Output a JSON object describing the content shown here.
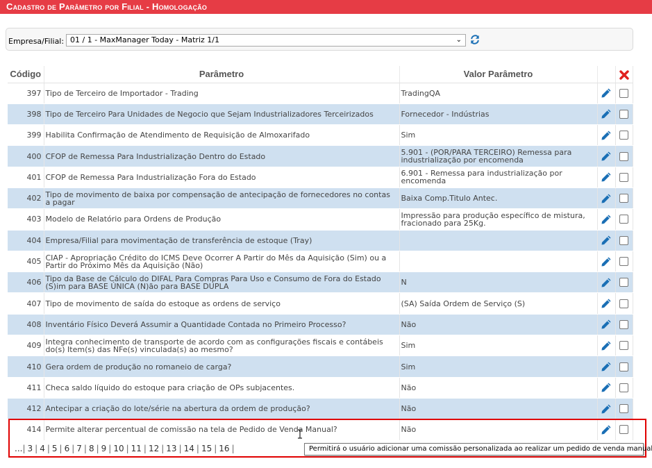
{
  "page": {
    "title": "Cadastro de Parâmetro por Filial  - Homologação"
  },
  "filter": {
    "label": "Empresa/Filial:",
    "selected": "01 / 1 - MaxManager Today - Matriz 1/1"
  },
  "table": {
    "headers": {
      "code": "Código",
      "param": "Parâmetro",
      "value": "Valor Parâmetro"
    },
    "rows": [
      {
        "code": "397",
        "param": "Tipo de Terceiro de Importador - Trading",
        "value": "TradingQA"
      },
      {
        "code": "398",
        "param": "Tipo de Terceiro Para Unidades de Negocio que Sejam Industrializadores Terceirizados",
        "value": "Fornecedor - Indústrias"
      },
      {
        "code": "399",
        "param": "Habilita Confirmação de Atendimento de Requisição de Almoxarifado",
        "value": "Sim"
      },
      {
        "code": "400",
        "param": "CFOP de Remessa Para Industrialização Dentro do Estado",
        "value": "5.901 - (POR/PARA TERCEIRO) Remessa para industrialização por encomenda"
      },
      {
        "code": "401",
        "param": "CFOP de Remessa Para Industrialização Fora do Estado",
        "value": "6.901 - Remessa para industrialização por encomenda"
      },
      {
        "code": "402",
        "param": "Tipo de movimento de baixa por compensação de antecipação de fornecedores no contas a pagar",
        "value": "Baixa Comp.Titulo Antec."
      },
      {
        "code": "403",
        "param": "Modelo de Relatório para Ordens de Produção",
        "value": "Impressão para produção específico de mistura, fracionado para 25Kg."
      },
      {
        "code": "404",
        "param": "Empresa/Filial para movimentação de transferência de estoque (Tray)",
        "value": ""
      },
      {
        "code": "405",
        "param": "CIAP - Apropriação Crédito do ICMS Deve Ocorrer A Partir do Mês da Aquisição (Sim) ou a Partir do Próximo Mês da Aquisição (Não)",
        "value": ""
      },
      {
        "code": "406",
        "param": "Tipo da Base de Cálculo do DIFAL Para Compras Para Uso e Consumo de Fora do Estado (S)im para BASE ÚNICA (N)ão para BASE DUPLA",
        "value": "N"
      },
      {
        "code": "407",
        "param": "Tipo de movimento de saída do estoque as ordens de serviço",
        "value": "(SA) Saída Ordem de Serviço (S)"
      },
      {
        "code": "408",
        "param": "Inventário Físico Deverá Assumir a Quantidade Contada no Primeiro Processo?",
        "value": "Não"
      },
      {
        "code": "409",
        "param": "Integra conhecimento de transporte de acordo com as configurações fiscais e contábeis do(s) Item(s) das NFe(s) vinculada(s) ao mesmo?",
        "value": "Sim"
      },
      {
        "code": "410",
        "param": "Gera ordem de produção no romaneio de carga?",
        "value": "Sim"
      },
      {
        "code": "411",
        "param": "Checa saldo líquido do estoque para criação de OPs subjacentes.",
        "value": "Não"
      },
      {
        "code": "412",
        "param": "Antecipar a criação do lote/série na abertura da ordem de produção?",
        "value": "Não"
      },
      {
        "code": "414",
        "param": "Permite alterar percentual de comissão na tela de Pedido de Venda Manual?",
        "value": "Não"
      }
    ]
  },
  "pager": {
    "prefix": "...",
    "pages": [
      "3",
      "4",
      "5",
      "6",
      "7",
      "8",
      "9",
      "10",
      "11",
      "12",
      "13",
      "14",
      "15",
      "16"
    ]
  },
  "tooltip": {
    "text": "Permitirá o usuário adicionar uma comissão personalizada ao realizar um pedido de venda manual."
  },
  "colors": {
    "title_bar": "#e63c45",
    "row_alt": "#cfe0f0",
    "highlight": "#e00000",
    "pencil": "#1a6fb5",
    "delete": "#e0201e"
  }
}
